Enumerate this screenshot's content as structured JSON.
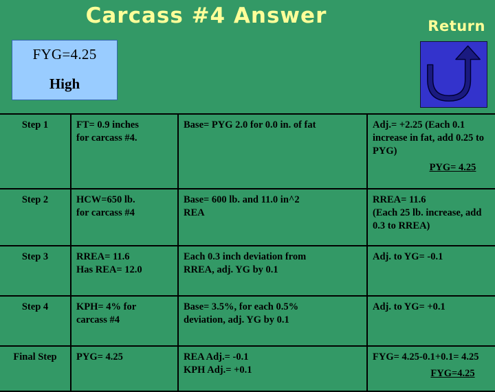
{
  "slide": {
    "title": "Carcass #4 Answer",
    "background_color": "#339966",
    "title_color": "#FFFF99"
  },
  "return_control": {
    "label": "Return",
    "icon": "u-turn-arrow-up-icon",
    "button_color": "#3333CC",
    "arrow_color": "#1A1A80"
  },
  "result_box": {
    "value_label": "FYG=4.25",
    "grade_label": "High",
    "fill_color": "#99CCFF",
    "border_color": "#3366AA"
  },
  "table": {
    "rows": [
      {
        "step": "Step 1",
        "measure": [
          "FT= 0.9 inches",
          "for carcass #4."
        ],
        "base": [
          "Base= PYG 2.0 for 0.0 in. of fat"
        ],
        "adjust": [
          "Adj.= +2.25 (Each 0.1",
          "increase in fat, add 0.25 to",
          "PYG)"
        ],
        "adjust_result": "PYG= 4.25"
      },
      {
        "step": "Step 2",
        "measure": [
          "HCW=650 lb.",
          "for carcass #4"
        ],
        "base": [
          "Base= 600 lb. and 11.0 in^2",
          "REA"
        ],
        "adjust": [
          "RREA= 11.6",
          "(Each 25 lb. increase, add",
          "0.3 to RREA)"
        ],
        "adjust_result": ""
      },
      {
        "step": "Step 3",
        "measure": [
          "RREA= 11.6",
          "Has REA= 12.0"
        ],
        "base": [
          "Each 0.3 inch deviation from",
          "RREA, adj. YG by 0.1"
        ],
        "adjust": [
          "Adj. to YG= -0.1"
        ],
        "adjust_result": ""
      },
      {
        "step": "Step 4",
        "measure": [
          "KPH= 4% for",
          "carcass #4"
        ],
        "base": [
          "Base= 3.5%, for each 0.5%",
          "deviation, adj. YG by 0.1"
        ],
        "adjust": [
          "Adj. to YG= +0.1"
        ],
        "adjust_result": ""
      },
      {
        "step": "Final Step",
        "measure": [
          "PYG= 4.25"
        ],
        "base": [
          "REA Adj.= -0.1",
          "KPH Adj.= +0.1"
        ],
        "adjust": [
          "FYG= 4.25-0.1+0.1= 4.25"
        ],
        "adjust_result": "FYG=4.25"
      }
    ]
  }
}
